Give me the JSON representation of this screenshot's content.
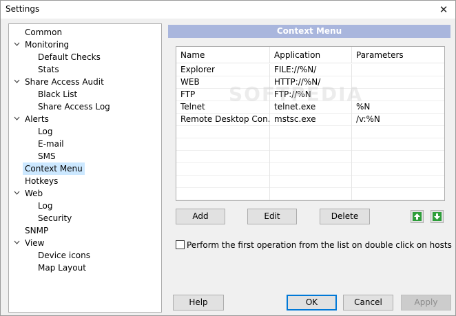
{
  "window": {
    "title": "Settings",
    "close_glyph": "✕"
  },
  "tree": {
    "items": [
      {
        "label": "Common",
        "level": 0,
        "expandable": false
      },
      {
        "label": "Monitoring",
        "level": 0,
        "expandable": true
      },
      {
        "label": "Default Checks",
        "level": 1,
        "expandable": false
      },
      {
        "label": "Stats",
        "level": 1,
        "expandable": false
      },
      {
        "label": "Share Access Audit",
        "level": 0,
        "expandable": true
      },
      {
        "label": "Black List",
        "level": 1,
        "expandable": false
      },
      {
        "label": "Share Access Log",
        "level": 1,
        "expandable": false
      },
      {
        "label": "Alerts",
        "level": 0,
        "expandable": true
      },
      {
        "label": "Log",
        "level": 1,
        "expandable": false
      },
      {
        "label": "E-mail",
        "level": 1,
        "expandable": false
      },
      {
        "label": "SMS",
        "level": 1,
        "expandable": false
      },
      {
        "label": "Context Menu",
        "level": 0,
        "expandable": false,
        "selected": true
      },
      {
        "label": "Hotkeys",
        "level": 0,
        "expandable": false
      },
      {
        "label": "Web",
        "level": 0,
        "expandable": true
      },
      {
        "label": "Log",
        "level": 1,
        "expandable": false
      },
      {
        "label": "Security",
        "level": 1,
        "expandable": false
      },
      {
        "label": "SNMP",
        "level": 0,
        "expandable": false
      },
      {
        "label": "View",
        "level": 0,
        "expandable": true
      },
      {
        "label": "Device icons",
        "level": 1,
        "expandable": false
      },
      {
        "label": "Map Layout",
        "level": 1,
        "expandable": false
      }
    ]
  },
  "panel": {
    "header": "Context Menu",
    "columns": [
      "Name",
      "Application",
      "Parameters"
    ],
    "rows": [
      [
        "Explorer",
        "FILE://%N/",
        ""
      ],
      [
        "WEB",
        "HTTP://%N/",
        ""
      ],
      [
        "FTP",
        "FTP://%N",
        ""
      ],
      [
        "Telnet",
        "telnet.exe",
        "%N"
      ],
      [
        "Remote Desktop Con...",
        "mstsc.exe",
        "/v:%N"
      ],
      [
        "",
        "",
        ""
      ],
      [
        "",
        "",
        ""
      ],
      [
        "",
        "",
        ""
      ],
      [
        "",
        "",
        ""
      ],
      [
        "",
        "",
        ""
      ],
      [
        "",
        "",
        ""
      ]
    ],
    "watermark": "SOFTPEDIA",
    "buttons": {
      "add": "Add",
      "edit": "Edit",
      "delete": "Delete"
    },
    "move_up_icon": "arrow-up-icon",
    "move_down_icon": "arrow-down-icon",
    "arrow_color": "#2e9e3a",
    "checkbox_label": "Perform the first operation from the list on double click on hosts",
    "checkbox_checked": false
  },
  "footer": {
    "help": "Help",
    "ok": "OK",
    "cancel": "Cancel",
    "apply": "Apply"
  },
  "colors": {
    "header_bg": "#a9b6dd",
    "selection": "#cce8ff",
    "default_border": "#0078d7"
  }
}
